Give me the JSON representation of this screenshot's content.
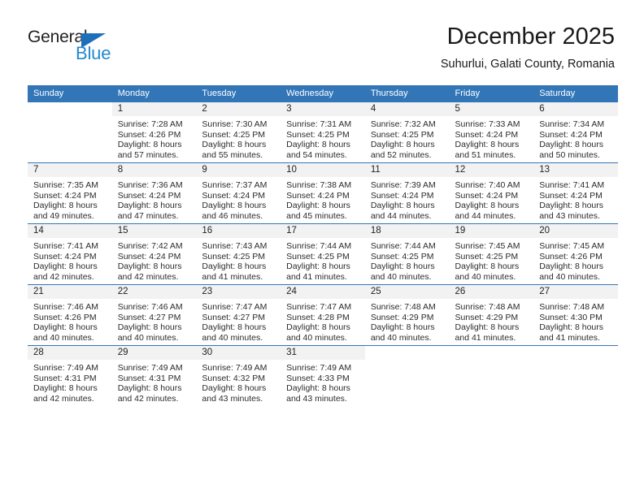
{
  "brand": {
    "name_top": "General",
    "name_bottom": "Blue",
    "triangle_color": "#1c6fb8",
    "blue_text_color": "#2489cd"
  },
  "header": {
    "title": "December 2025",
    "subtitle": "Suhurlui, Galati County, Romania"
  },
  "theme": {
    "header_row_bg": "#3276b8",
    "header_row_text": "#ffffff",
    "daynum_band_bg": "#f2f2f2",
    "week_divider": "#3276b8",
    "body_text": "#2b2b2b"
  },
  "weekdays": [
    "Sunday",
    "Monday",
    "Tuesday",
    "Wednesday",
    "Thursday",
    "Friday",
    "Saturday"
  ],
  "weeks": [
    [
      {
        "day": "",
        "sunrise": "",
        "sunset": "",
        "daylight_1": "",
        "daylight_2": "",
        "blank": true
      },
      {
        "day": "1",
        "sunrise": "Sunrise: 7:28 AM",
        "sunset": "Sunset: 4:26 PM",
        "daylight_1": "Daylight: 8 hours",
        "daylight_2": "and 57 minutes."
      },
      {
        "day": "2",
        "sunrise": "Sunrise: 7:30 AM",
        "sunset": "Sunset: 4:25 PM",
        "daylight_1": "Daylight: 8 hours",
        "daylight_2": "and 55 minutes."
      },
      {
        "day": "3",
        "sunrise": "Sunrise: 7:31 AM",
        "sunset": "Sunset: 4:25 PM",
        "daylight_1": "Daylight: 8 hours",
        "daylight_2": "and 54 minutes."
      },
      {
        "day": "4",
        "sunrise": "Sunrise: 7:32 AM",
        "sunset": "Sunset: 4:25 PM",
        "daylight_1": "Daylight: 8 hours",
        "daylight_2": "and 52 minutes."
      },
      {
        "day": "5",
        "sunrise": "Sunrise: 7:33 AM",
        "sunset": "Sunset: 4:24 PM",
        "daylight_1": "Daylight: 8 hours",
        "daylight_2": "and 51 minutes."
      },
      {
        "day": "6",
        "sunrise": "Sunrise: 7:34 AM",
        "sunset": "Sunset: 4:24 PM",
        "daylight_1": "Daylight: 8 hours",
        "daylight_2": "and 50 minutes."
      }
    ],
    [
      {
        "day": "7",
        "sunrise": "Sunrise: 7:35 AM",
        "sunset": "Sunset: 4:24 PM",
        "daylight_1": "Daylight: 8 hours",
        "daylight_2": "and 49 minutes."
      },
      {
        "day": "8",
        "sunrise": "Sunrise: 7:36 AM",
        "sunset": "Sunset: 4:24 PM",
        "daylight_1": "Daylight: 8 hours",
        "daylight_2": "and 47 minutes."
      },
      {
        "day": "9",
        "sunrise": "Sunrise: 7:37 AM",
        "sunset": "Sunset: 4:24 PM",
        "daylight_1": "Daylight: 8 hours",
        "daylight_2": "and 46 minutes."
      },
      {
        "day": "10",
        "sunrise": "Sunrise: 7:38 AM",
        "sunset": "Sunset: 4:24 PM",
        "daylight_1": "Daylight: 8 hours",
        "daylight_2": "and 45 minutes."
      },
      {
        "day": "11",
        "sunrise": "Sunrise: 7:39 AM",
        "sunset": "Sunset: 4:24 PM",
        "daylight_1": "Daylight: 8 hours",
        "daylight_2": "and 44 minutes."
      },
      {
        "day": "12",
        "sunrise": "Sunrise: 7:40 AM",
        "sunset": "Sunset: 4:24 PM",
        "daylight_1": "Daylight: 8 hours",
        "daylight_2": "and 44 minutes."
      },
      {
        "day": "13",
        "sunrise": "Sunrise: 7:41 AM",
        "sunset": "Sunset: 4:24 PM",
        "daylight_1": "Daylight: 8 hours",
        "daylight_2": "and 43 minutes."
      }
    ],
    [
      {
        "day": "14",
        "sunrise": "Sunrise: 7:41 AM",
        "sunset": "Sunset: 4:24 PM",
        "daylight_1": "Daylight: 8 hours",
        "daylight_2": "and 42 minutes."
      },
      {
        "day": "15",
        "sunrise": "Sunrise: 7:42 AM",
        "sunset": "Sunset: 4:24 PM",
        "daylight_1": "Daylight: 8 hours",
        "daylight_2": "and 42 minutes."
      },
      {
        "day": "16",
        "sunrise": "Sunrise: 7:43 AM",
        "sunset": "Sunset: 4:25 PM",
        "daylight_1": "Daylight: 8 hours",
        "daylight_2": "and 41 minutes."
      },
      {
        "day": "17",
        "sunrise": "Sunrise: 7:44 AM",
        "sunset": "Sunset: 4:25 PM",
        "daylight_1": "Daylight: 8 hours",
        "daylight_2": "and 41 minutes."
      },
      {
        "day": "18",
        "sunrise": "Sunrise: 7:44 AM",
        "sunset": "Sunset: 4:25 PM",
        "daylight_1": "Daylight: 8 hours",
        "daylight_2": "and 40 minutes."
      },
      {
        "day": "19",
        "sunrise": "Sunrise: 7:45 AM",
        "sunset": "Sunset: 4:25 PM",
        "daylight_1": "Daylight: 8 hours",
        "daylight_2": "and 40 minutes."
      },
      {
        "day": "20",
        "sunrise": "Sunrise: 7:45 AM",
        "sunset": "Sunset: 4:26 PM",
        "daylight_1": "Daylight: 8 hours",
        "daylight_2": "and 40 minutes."
      }
    ],
    [
      {
        "day": "21",
        "sunrise": "Sunrise: 7:46 AM",
        "sunset": "Sunset: 4:26 PM",
        "daylight_1": "Daylight: 8 hours",
        "daylight_2": "and 40 minutes."
      },
      {
        "day": "22",
        "sunrise": "Sunrise: 7:46 AM",
        "sunset": "Sunset: 4:27 PM",
        "daylight_1": "Daylight: 8 hours",
        "daylight_2": "and 40 minutes."
      },
      {
        "day": "23",
        "sunrise": "Sunrise: 7:47 AM",
        "sunset": "Sunset: 4:27 PM",
        "daylight_1": "Daylight: 8 hours",
        "daylight_2": "and 40 minutes."
      },
      {
        "day": "24",
        "sunrise": "Sunrise: 7:47 AM",
        "sunset": "Sunset: 4:28 PM",
        "daylight_1": "Daylight: 8 hours",
        "daylight_2": "and 40 minutes."
      },
      {
        "day": "25",
        "sunrise": "Sunrise: 7:48 AM",
        "sunset": "Sunset: 4:29 PM",
        "daylight_1": "Daylight: 8 hours",
        "daylight_2": "and 40 minutes."
      },
      {
        "day": "26",
        "sunrise": "Sunrise: 7:48 AM",
        "sunset": "Sunset: 4:29 PM",
        "daylight_1": "Daylight: 8 hours",
        "daylight_2": "and 41 minutes."
      },
      {
        "day": "27",
        "sunrise": "Sunrise: 7:48 AM",
        "sunset": "Sunset: 4:30 PM",
        "daylight_1": "Daylight: 8 hours",
        "daylight_2": "and 41 minutes."
      }
    ],
    [
      {
        "day": "28",
        "sunrise": "Sunrise: 7:49 AM",
        "sunset": "Sunset: 4:31 PM",
        "daylight_1": "Daylight: 8 hours",
        "daylight_2": "and 42 minutes."
      },
      {
        "day": "29",
        "sunrise": "Sunrise: 7:49 AM",
        "sunset": "Sunset: 4:31 PM",
        "daylight_1": "Daylight: 8 hours",
        "daylight_2": "and 42 minutes."
      },
      {
        "day": "30",
        "sunrise": "Sunrise: 7:49 AM",
        "sunset": "Sunset: 4:32 PM",
        "daylight_1": "Daylight: 8 hours",
        "daylight_2": "and 43 minutes."
      },
      {
        "day": "31",
        "sunrise": "Sunrise: 7:49 AM",
        "sunset": "Sunset: 4:33 PM",
        "daylight_1": "Daylight: 8 hours",
        "daylight_2": "and 43 minutes."
      },
      {
        "day": "",
        "sunrise": "",
        "sunset": "",
        "daylight_1": "",
        "daylight_2": "",
        "blank": true
      },
      {
        "day": "",
        "sunrise": "",
        "sunset": "",
        "daylight_1": "",
        "daylight_2": "",
        "blank": true
      },
      {
        "day": "",
        "sunrise": "",
        "sunset": "",
        "daylight_1": "",
        "daylight_2": "",
        "blank": true
      }
    ]
  ]
}
